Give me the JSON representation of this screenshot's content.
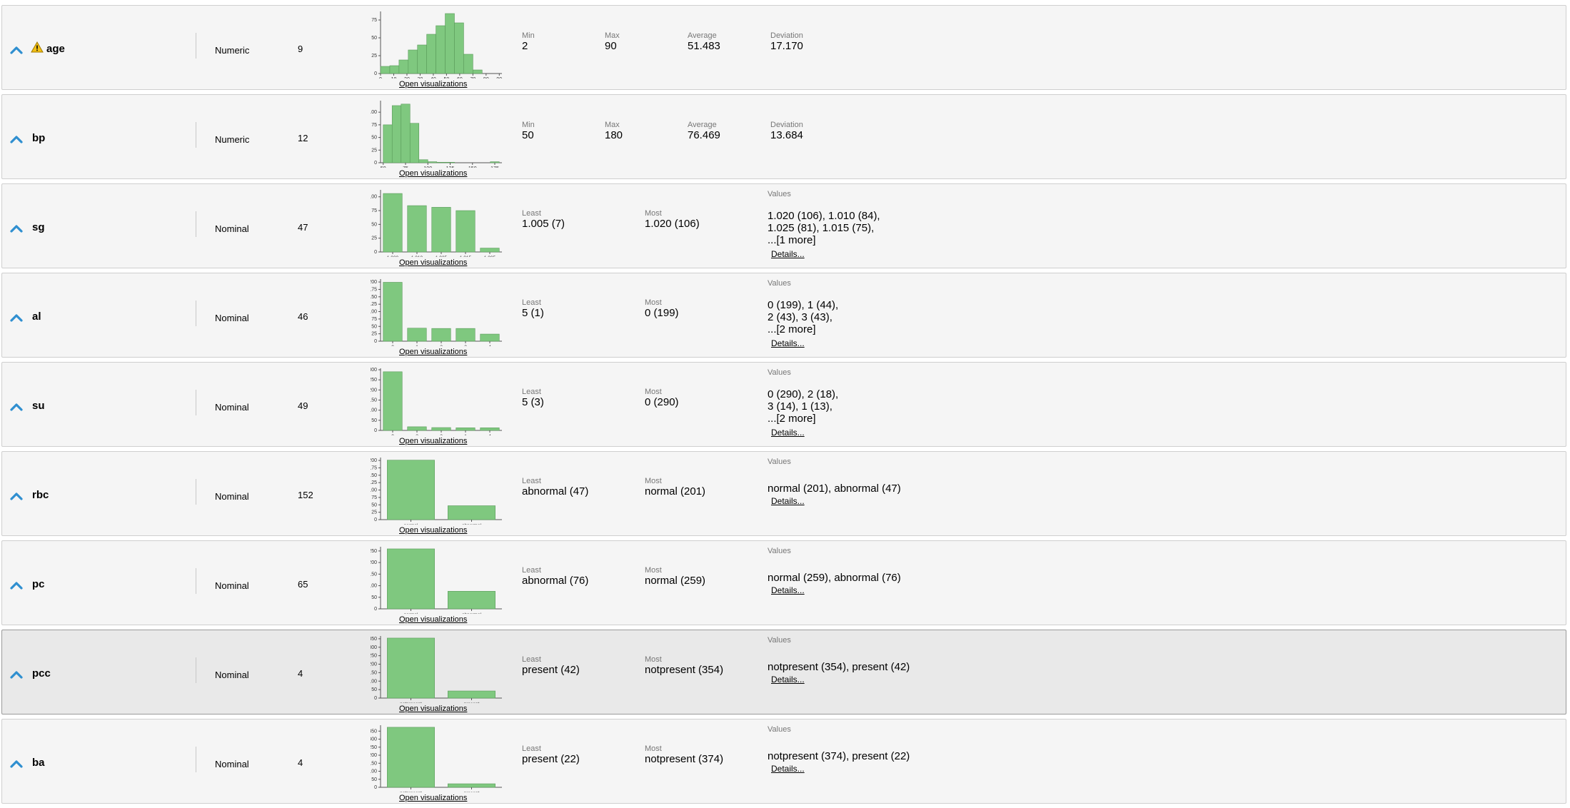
{
  "colors": {
    "bar": "#7fc87f",
    "bar_stroke": "#5a9a5a",
    "chevron": "#2f8fd0",
    "warning": "#f2c014"
  },
  "open_vis_label": "Open visualizations",
  "details_label": "Details...",
  "values_label": "Values",
  "least_label": "Least",
  "most_label": "Most",
  "rows": [
    {
      "name": "age",
      "type": "Numeric",
      "missing": "9",
      "warning": true,
      "selected": false,
      "stats_kind": "numeric",
      "stats": [
        {
          "label": "Min",
          "value": "2"
        },
        {
          "label": "Max",
          "value": "90"
        },
        {
          "label": "Average",
          "value": "51.483"
        },
        {
          "label": "Deviation",
          "value": "17.170"
        }
      ],
      "chart_data": {
        "type": "bar",
        "binned": true,
        "x": [
          0,
          7,
          14,
          21,
          28,
          35,
          42,
          49,
          56,
          63,
          70,
          77,
          84,
          91
        ],
        "values": [
          10,
          11,
          19,
          33,
          40,
          55,
          67,
          84,
          71,
          27,
          5,
          0
        ],
        "ylim": [
          0,
          85
        ],
        "yticks": [
          0,
          25,
          50,
          75
        ],
        "xticks": [
          "0",
          "10",
          "20",
          "30",
          "40",
          "50",
          "60",
          "70",
          "80",
          "90"
        ],
        "xtick_values": [
          0,
          10,
          20,
          30,
          40,
          50,
          60,
          70,
          80,
          90
        ],
        "xlim": [
          0,
          92
        ]
      }
    },
    {
      "name": "bp",
      "type": "Numeric",
      "missing": "12",
      "warning": false,
      "selected": false,
      "stats_kind": "numeric",
      "stats": [
        {
          "label": "Min",
          "value": "50"
        },
        {
          "label": "Max",
          "value": "180"
        },
        {
          "label": "Average",
          "value": "76.469"
        },
        {
          "label": "Deviation",
          "value": "13.684"
        }
      ],
      "chart_data": {
        "type": "bar",
        "binned": true,
        "x": [
          50,
          60,
          70,
          80,
          90,
          100,
          110,
          120,
          130,
          140,
          150,
          160,
          170,
          180
        ],
        "values": [
          75,
          113,
          116,
          78,
          6,
          2,
          1,
          1,
          0,
          0,
          0,
          0,
          2
        ],
        "ylim": [
          0,
          120
        ],
        "yticks": [
          0,
          25,
          50,
          75,
          100
        ],
        "xticks": [
          "50",
          "75",
          "100",
          "125",
          "150",
          "175"
        ],
        "xtick_values": [
          50,
          75,
          100,
          125,
          150,
          175
        ],
        "xlim": [
          47,
          183
        ]
      }
    },
    {
      "name": "sg",
      "type": "Nominal",
      "missing": "47",
      "warning": false,
      "selected": false,
      "stats_kind": "nominal",
      "least": "1.005 (7)",
      "most": "1.020 (106)",
      "values_lines": [
        "1.020 (106), 1.010 (84),",
        "1.025 (81), 1.015 (75),",
        "...[1 more]"
      ],
      "chart_data": {
        "type": "bar",
        "categories": [
          "1.020",
          "1.010",
          "1.025",
          "1.015",
          "1.005"
        ],
        "values": [
          106,
          84,
          81,
          75,
          7
        ],
        "ylim": [
          0,
          110
        ],
        "yticks": [
          0,
          25,
          50,
          75,
          100
        ]
      }
    },
    {
      "name": "al",
      "type": "Nominal",
      "missing": "46",
      "warning": false,
      "selected": false,
      "stats_kind": "nominal",
      "least": "5 (1)",
      "most": "0 (199)",
      "values_lines": [
        "0 (199), 1 (44),",
        "2 (43), 3 (43),",
        "...[2 more]"
      ],
      "chart_data": {
        "type": "bar",
        "categories": [
          "0",
          "1",
          "2",
          "3",
          "4"
        ],
        "values": [
          199,
          44,
          43,
          43,
          24
        ],
        "ylim": [
          0,
          205
        ],
        "yticks": [
          0,
          25,
          50,
          75,
          100,
          125,
          150,
          175,
          200
        ]
      }
    },
    {
      "name": "su",
      "type": "Nominal",
      "missing": "49",
      "warning": false,
      "selected": false,
      "stats_kind": "nominal",
      "least": "5 (3)",
      "most": "0 (290)",
      "values_lines": [
        "0 (290), 2 (18),",
        "3 (14), 1 (13),",
        "...[2 more]"
      ],
      "chart_data": {
        "type": "bar",
        "categories": [
          "0",
          "2",
          "3",
          "1",
          "4"
        ],
        "values": [
          290,
          18,
          14,
          13,
          13
        ],
        "ylim": [
          0,
          300
        ],
        "yticks": [
          0,
          50,
          100,
          150,
          200,
          250,
          300
        ]
      }
    },
    {
      "name": "rbc",
      "type": "Nominal",
      "missing": "152",
      "warning": false,
      "selected": false,
      "stats_kind": "nominal",
      "least": "abnormal (47)",
      "most": "normal (201)",
      "values_lines": [
        "normal (201), abnormal (47)"
      ],
      "chart_data": {
        "type": "bar",
        "categories": [
          "normal",
          "abnormal"
        ],
        "values": [
          201,
          47
        ],
        "ylim": [
          0,
          205
        ],
        "yticks": [
          0,
          25,
          50,
          75,
          100,
          125,
          150,
          175,
          200
        ]
      }
    },
    {
      "name": "pc",
      "type": "Nominal",
      "missing": "65",
      "warning": false,
      "selected": false,
      "stats_kind": "nominal",
      "least": "abnormal (76)",
      "most": "normal (259)",
      "values_lines": [
        "normal (259), abnormal (76)"
      ],
      "chart_data": {
        "type": "bar",
        "categories": [
          "normal",
          "abnormal"
        ],
        "values": [
          259,
          76
        ],
        "ylim": [
          0,
          262
        ],
        "yticks": [
          0,
          50,
          100,
          150,
          200,
          250
        ]
      }
    },
    {
      "name": "pcc",
      "type": "Nominal",
      "missing": "4",
      "warning": false,
      "selected": true,
      "stats_kind": "nominal",
      "least": "present (42)",
      "most": "notpresent (354)",
      "values_lines": [
        "notpresent (354), present (42)"
      ],
      "chart_data": {
        "type": "bar",
        "categories": [
          "notpresent",
          "present"
        ],
        "values": [
          354,
          42
        ],
        "ylim": [
          0,
          358
        ],
        "yticks": [
          0,
          50,
          100,
          150,
          200,
          250,
          300,
          350
        ]
      }
    },
    {
      "name": "ba",
      "type": "Nominal",
      "missing": "4",
      "warning": false,
      "selected": false,
      "stats_kind": "nominal",
      "least": "present (22)",
      "most": "notpresent (374)",
      "values_lines": [
        "notpresent (374), present (22)"
      ],
      "chart_data": {
        "type": "bar",
        "categories": [
          "notpresent",
          "present"
        ],
        "values": [
          374,
          22
        ],
        "ylim": [
          0,
          378
        ],
        "yticks": [
          0,
          50,
          100,
          150,
          200,
          250,
          300,
          350
        ]
      }
    }
  ]
}
